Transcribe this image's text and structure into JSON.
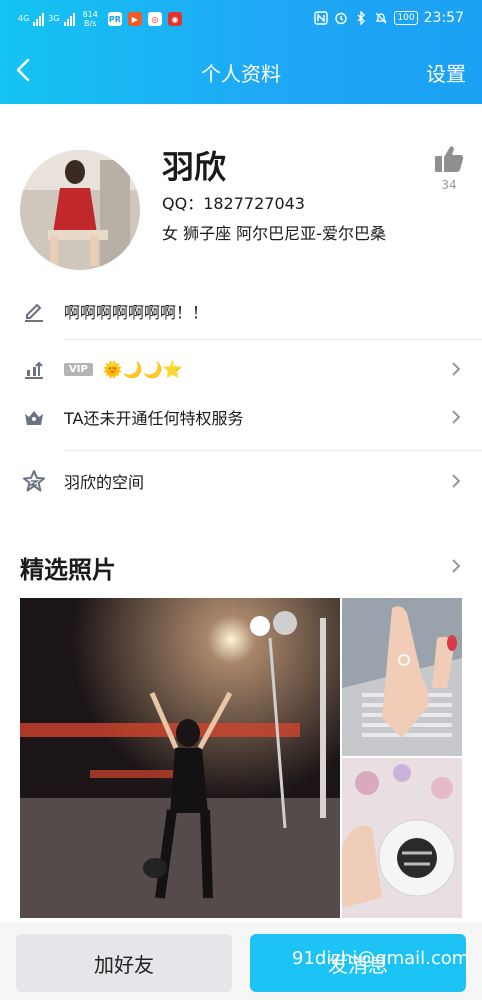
{
  "status_bar": {
    "sim1": "4G",
    "sim2": "3G",
    "net_speed_value": "814",
    "net_speed_unit": "B/s",
    "battery": "100",
    "time": "23:57"
  },
  "nav": {
    "title": "个人资料",
    "settings_label": "设置"
  },
  "profile": {
    "name": "羽欣",
    "qq": "QQ：1827727043",
    "info": "女  狮子座  阿尔巴尼亚-爱尔巴桑",
    "likes": "34"
  },
  "rows": {
    "signature": "啊啊啊啊啊啊啊！！",
    "vip_badge": "VIP",
    "level_icons": "🌞🌙🌙⭐",
    "privilege": "TA还未开通任何特权服务",
    "space": "羽欣的空间"
  },
  "photos": {
    "title": "精选照片"
  },
  "bottom": {
    "add_friend": "加好友",
    "send_message": "发消息",
    "watermark": "91dizhi@gmail.com"
  },
  "colors": {
    "header_start": "#14c4f2",
    "header_end": "#1aa1f3",
    "primary_button": "#1ec3f6",
    "secondary_button": "#e6e6ea"
  }
}
